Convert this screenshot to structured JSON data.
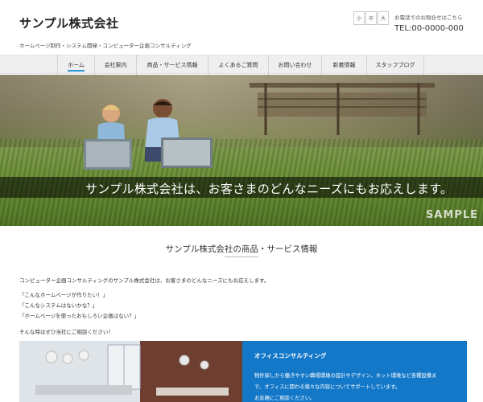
{
  "header": {
    "site_title": "サンプル株式会社",
    "tagline": "ホームページ制作・システム開発・コンピューター企画コンサルティング",
    "font_sizes": [
      "小",
      "中",
      "大"
    ],
    "contact_label": "お電話でのお問合せはこちら",
    "tel": "TEL:00-0000-000"
  },
  "nav": {
    "items": [
      {
        "label": "ホーム",
        "active": true
      },
      {
        "label": "会社案内"
      },
      {
        "label": "商品・サービス情報"
      },
      {
        "label": "よくあるご質問"
      },
      {
        "label": "お問い合わせ"
      },
      {
        "label": "新着情報"
      },
      {
        "label": "スタッフブログ"
      }
    ]
  },
  "hero": {
    "caption": "サンプル株式会社は、お客さまのどんなニーズにもお応えします。",
    "watermark": "SAMPLE"
  },
  "content": {
    "section_title": "サンプル株式会社の商品・サービス情報",
    "intro": "コンピューター企画コンサルティングのサンプル株式会社は、お客さまのどんなニーズにもお応えします。",
    "quotes": [
      "「こんなホームページが作りたい！」",
      "「こんなシステムはないかな？」",
      "「ホームページを使ったおもしろい企画はない？」"
    ],
    "closing": "そんな時はぜひ当社にご相談ください！"
  },
  "feature": {
    "title": "オフィスコンサルティング",
    "lines": [
      "物件探しから働きやすい職場環境の設計やデザイン、ネット環境など各種設備ま",
      "で、オフィスに関わる様々な内容についてサポートしています。",
      "お気軽にご相談ください。"
    ]
  },
  "colors": {
    "accent": "#2b9ad6",
    "feature_panel": "#1478c8",
    "nav_bg": "#efefef"
  }
}
